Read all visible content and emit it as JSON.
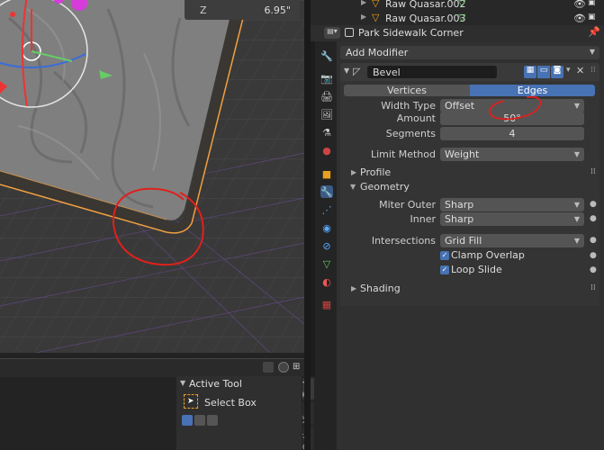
{
  "viewport": {
    "z_label": "Z",
    "z_value": "6.95\"",
    "top_partial_value": "°"
  },
  "active_tool": {
    "title": "Active Tool",
    "tool_name": "Select Box"
  },
  "side_tabs": [
    "Tool",
    "View",
    "Options"
  ],
  "outliner": {
    "items": [
      {
        "label": "Raw Quasar.002"
      },
      {
        "label": "Raw Quasar.003"
      }
    ]
  },
  "properties": {
    "object_name": "Park Sidewalk Corner",
    "add_modifier": "Add Modifier",
    "modifier": {
      "name": "Bevel",
      "affect_tabs": [
        "Vertices",
        "Edges"
      ],
      "active_affect": "Edges",
      "fields": {
        "width_type_label": "Width Type",
        "width_type_value": "Offset",
        "amount_label": "Amount",
        "amount_value": "50°",
        "segments_label": "Segments",
        "segments_value": "4",
        "limit_method_label": "Limit Method",
        "limit_method_value": "Weight"
      },
      "sections": {
        "profile": "Profile",
        "geometry": "Geometry",
        "shading": "Shading"
      },
      "geometry": {
        "miter_outer_label": "Miter Outer",
        "miter_outer_value": "Sharp",
        "inner_label": "Inner",
        "inner_value": "Sharp",
        "intersections_label": "Intersections",
        "intersections_value": "Grid Fill",
        "clamp_overlap": "Clamp Overlap",
        "loop_slide": "Loop Slide"
      }
    }
  },
  "colors": {
    "accent_blue": "#4772b3",
    "annotation_red": "#e0201c",
    "selection_orange": "#f0a040"
  }
}
